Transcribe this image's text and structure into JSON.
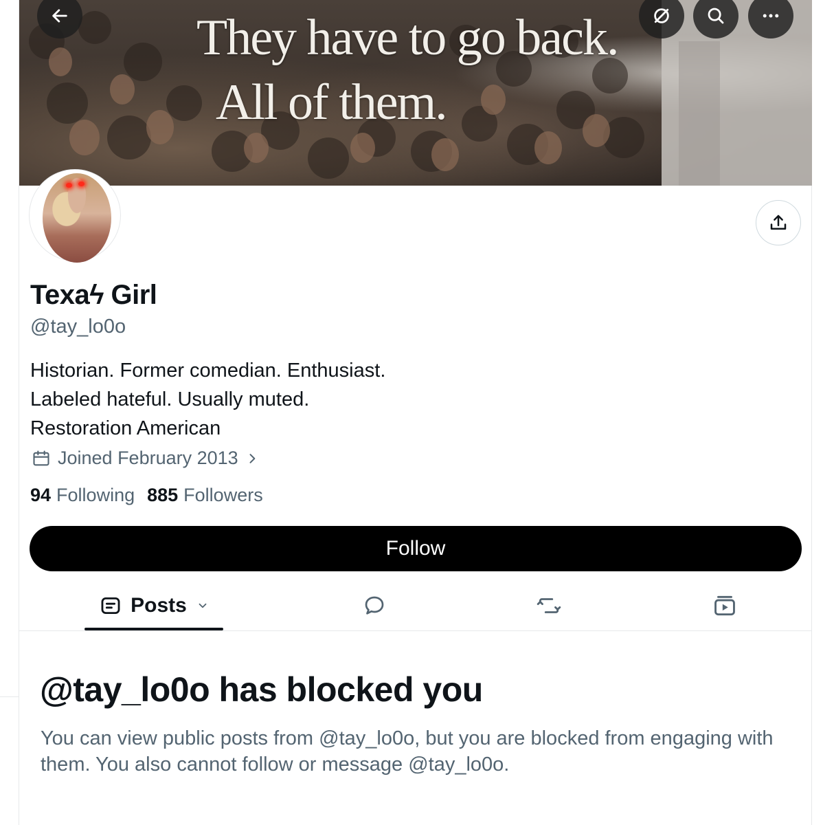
{
  "banner": {
    "line1": "They have to go back.",
    "line2": "All of them."
  },
  "icons": {
    "back": "arrow-left-icon",
    "grok": "slashed-circle-icon",
    "search": "search-icon",
    "more": "more-icon",
    "share": "share-icon",
    "calendar": "calendar-icon",
    "chevron": "chevron-right-icon",
    "posts": "posts-icon",
    "replies": "reply-icon",
    "reposts": "repost-icon",
    "media": "media-icon"
  },
  "profile": {
    "name": "Texaϟ Girl",
    "handle": "@tay_lo0o",
    "bio": [
      "Historian. Former comedian. Enthusiast.",
      "Labeled hateful. Usually muted.",
      "Restoration American"
    ],
    "joined": "Joined February 2013",
    "following_count": "94",
    "following_label": "Following",
    "followers_count": "885",
    "followers_label": "Followers"
  },
  "follow_button": "Follow",
  "tabs": {
    "posts_label": "Posts"
  },
  "blocked": {
    "title": "@tay_lo0o has blocked you",
    "message": "You can view public posts from @tay_lo0o, but you are blocked from engaging with them. You also cannot follow or message @tay_lo0o."
  },
  "colors": {
    "text_primary": "#0f1419",
    "text_secondary": "#536471",
    "button_black": "#000000",
    "border": "#e6e8ea"
  }
}
